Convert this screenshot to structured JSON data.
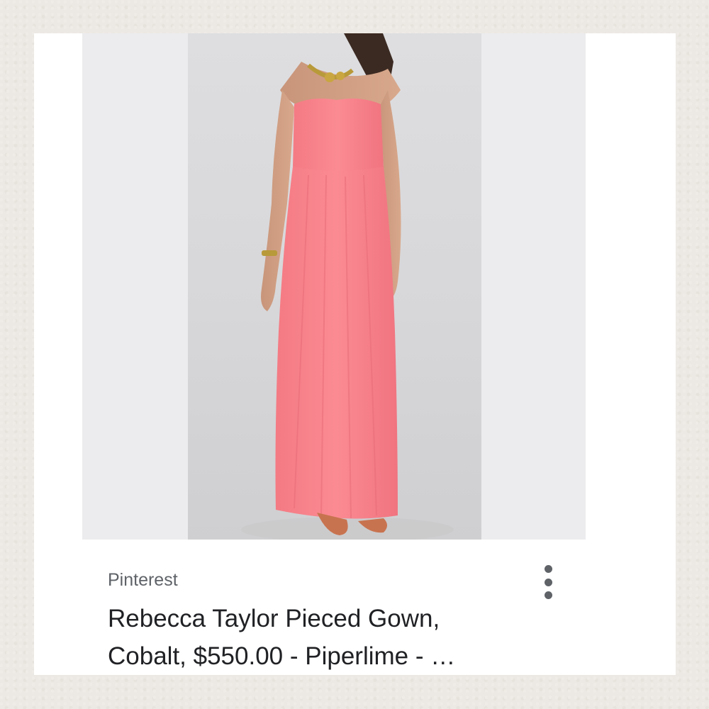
{
  "result": {
    "source": "Pinterest",
    "title_line1": "Rebecca Taylor Pieced Gown,",
    "title_line2": "Cobalt, $550.00 - Piperlime - …",
    "menu_icon": "more-vert-icon",
    "image_subject": "Model wearing a pink strapless maxi gown"
  },
  "colors": {
    "dress": "#f8818a",
    "text_primary": "#202124",
    "text_secondary": "#5f6368"
  }
}
